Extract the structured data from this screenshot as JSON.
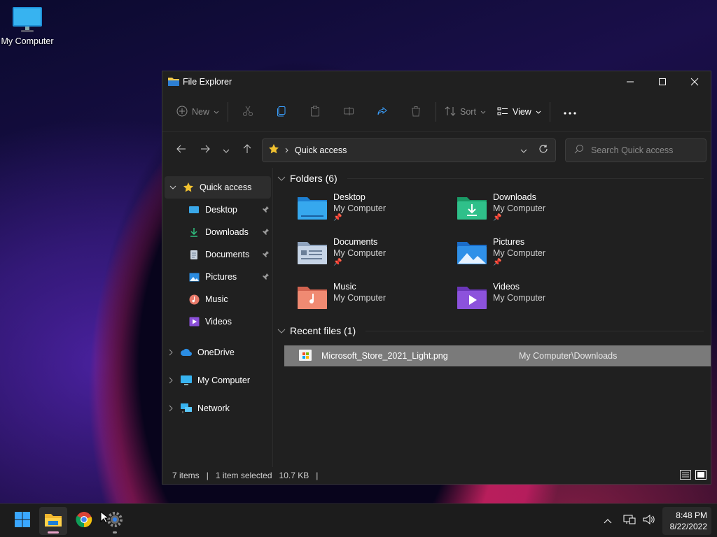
{
  "desktop": {
    "icon_label": "My Computer"
  },
  "window": {
    "title": "File Explorer",
    "toolbar": {
      "new_label": "New",
      "sort_label": "Sort",
      "view_label": "View"
    },
    "address": {
      "crumb": "Quick access"
    },
    "search": {
      "placeholder": "Search Quick access"
    },
    "sidebar": {
      "quick_access": "Quick access",
      "items": [
        {
          "label": "Desktop",
          "icon": "desktop-icon",
          "pinned": true
        },
        {
          "label": "Downloads",
          "icon": "download-icon",
          "pinned": true
        },
        {
          "label": "Documents",
          "icon": "document-icon",
          "pinned": true
        },
        {
          "label": "Pictures",
          "icon": "pictures-icon",
          "pinned": true
        },
        {
          "label": "Music",
          "icon": "music-icon",
          "pinned": false
        },
        {
          "label": "Videos",
          "icon": "videos-icon",
          "pinned": false
        }
      ],
      "onedrive": "OneDrive",
      "my_computer": "My Computer",
      "network": "Network"
    },
    "folders": {
      "header": "Folders (6)",
      "items": [
        {
          "name": "Desktop",
          "location": "My Computer",
          "pinned": true
        },
        {
          "name": "Downloads",
          "location": "My Computer",
          "pinned": true
        },
        {
          "name": "Documents",
          "location": "My Computer",
          "pinned": true
        },
        {
          "name": "Pictures",
          "location": "My Computer",
          "pinned": true
        },
        {
          "name": "Music",
          "location": "My Computer",
          "pinned": false
        },
        {
          "name": "Videos",
          "location": "My Computer",
          "pinned": false
        }
      ]
    },
    "recent": {
      "header": "Recent files (1)",
      "items": [
        {
          "name": "Microsoft_Store_2021_Light.png",
          "path": "My Computer\\Downloads"
        }
      ]
    },
    "status": {
      "count": "7 items",
      "selection": "1 item selected",
      "size": "10.7 KB",
      "separator": "|"
    }
  },
  "taskbar": {
    "time": "8:48 PM",
    "date": "8/22/2022"
  }
}
